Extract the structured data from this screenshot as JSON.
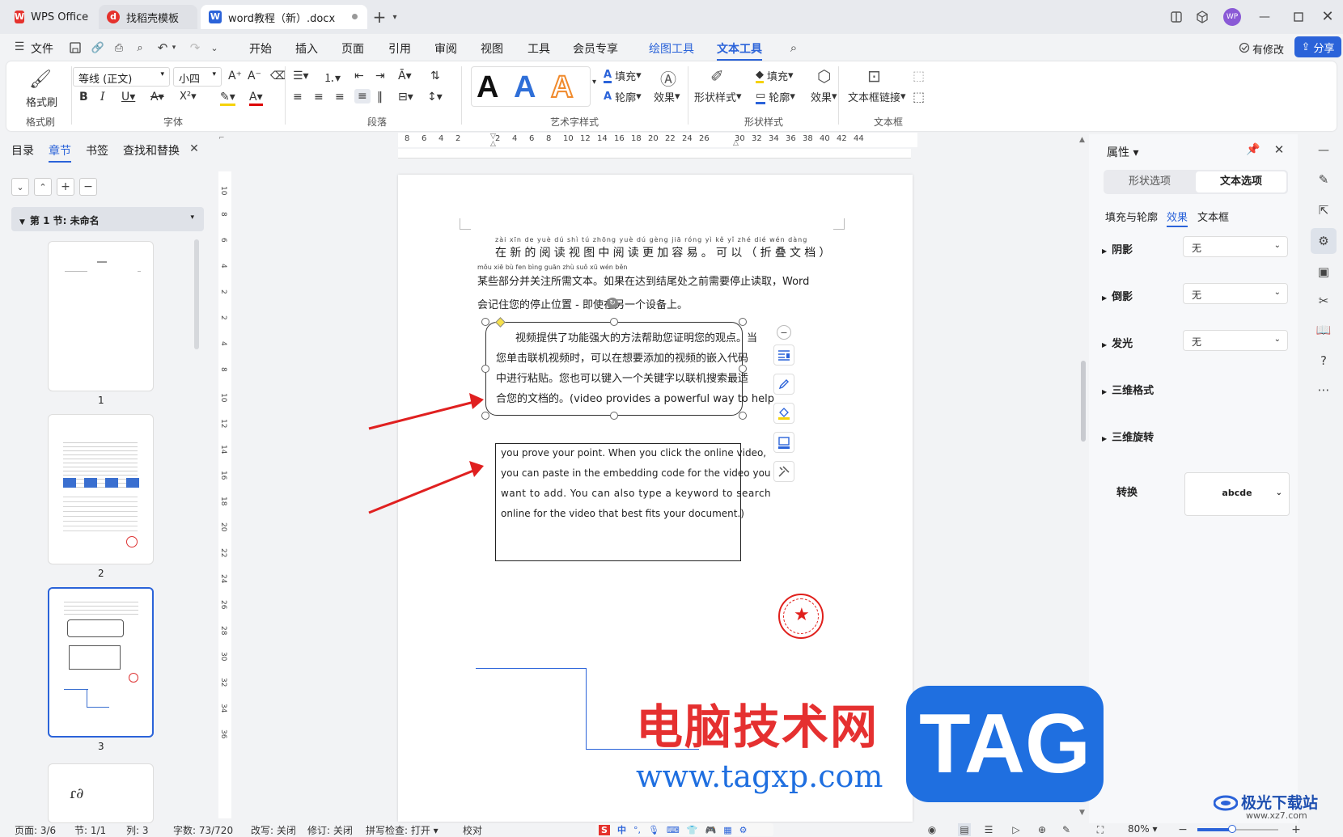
{
  "tabs": [
    {
      "label": "WPS Office"
    },
    {
      "label": "找稻壳模板"
    },
    {
      "label": "word教程（新）.docx"
    }
  ],
  "window": {
    "avatar": "WP"
  },
  "menu": {
    "file": "文件",
    "items": [
      "开始",
      "插入",
      "页面",
      "引用",
      "审阅",
      "视图",
      "工具",
      "会员专享",
      "绘图工具",
      "文本工具"
    ],
    "active": "文本工具",
    "modified": "有修改",
    "share": "分享"
  },
  "ribbon": {
    "format_painter": "格式刷",
    "group_format": "格式刷",
    "font_name": "等线 (正文)",
    "font_size": "小四",
    "group_font": "字体",
    "group_paragraph": "段落",
    "group_art": "艺术字样式",
    "fill": "填充",
    "outline": "轮廓",
    "effect": "效果",
    "shape_style": "形状样式",
    "group_shape": "形状样式",
    "fill2": "填充",
    "outline2": "轮廓",
    "effect2": "效果",
    "textbox_link": "文本框链接",
    "group_textbox": "文本框",
    "art_letter": "A"
  },
  "nav": {
    "tabs": [
      "目录",
      "章节",
      "书签",
      "查找和替换"
    ],
    "active": "章节",
    "section": "第 1 节: 未命名",
    "pages": [
      "1",
      "2",
      "3"
    ]
  },
  "ruler_h": [
    "8",
    "6",
    "4",
    "2",
    "2",
    "4",
    "6",
    "8",
    "10",
    "12",
    "14",
    "16",
    "18",
    "20",
    "22",
    "24",
    "26",
    "30",
    "32",
    "34",
    "36",
    "38",
    "40",
    "42",
    "44"
  ],
  "ruler_v": [
    "10",
    "8",
    "6",
    "4",
    "2",
    "2",
    "4",
    "8",
    "10",
    "12",
    "14",
    "16",
    "18",
    "20",
    "22",
    "24",
    "26",
    "28",
    "30",
    "32",
    "34",
    "36"
  ],
  "document": {
    "pinyin1": "zài xīn de yuè dú shì tú zhōng yuè dú gèng jiā róng yì   kě yǐ   zhé dié wén dàng",
    "line1": "在新的阅读视图中阅读更加容易。可以（折叠文档）",
    "pinyin2": "mǒu xiē bù fen bìng guān zhù suǒ xū wén běn",
    "line2": "某些部分并关注所需文本。如果在达到结尾处之前需要停止读取，Word",
    "line3": "会记住您的停止位置 - 即使在另一个设备上。",
    "box1": [
      "视频提供了功能强大的方法帮助您证明您的观点。当",
      "您单击联机视频时，可以在想要添加的视频的嵌入代码",
      "中进行粘贴。您也可以键入一个关键字以联机搜索最适",
      "合您的文档的。(video provides a powerful way to help"
    ],
    "box2": [
      "you prove your point. When you click the online video,",
      "you can paste in the embedding code for the video you",
      "want to add. You can also type a keyword to search",
      "online for the video that best fits your document.)"
    ]
  },
  "watermark": {
    "text": "电脑技术网",
    "url": "www.tagxp.com",
    "tag": "TAG",
    "site": "极光下载站",
    "site_url": "www.xz7.com"
  },
  "props": {
    "title": "属性",
    "tabs": [
      "形状选项",
      "文本选项"
    ],
    "active_tab": "文本选项",
    "subtabs": [
      "填充与轮廓",
      "效果",
      "文本框"
    ],
    "active_sub": "效果",
    "rows": [
      {
        "label": "阴影",
        "value": "无"
      },
      {
        "label": "倒影",
        "value": "无"
      },
      {
        "label": "发光",
        "value": "无"
      }
    ],
    "fmt3d": "三维格式",
    "rot3d": "三维旋转",
    "transform": "转换",
    "transform_value": "abcde"
  },
  "status": {
    "page": "页面: 3/6",
    "section": "节: 1/1",
    "column": "列: 3",
    "words": "字数: 73/720",
    "rewrite": "改写: 关闭",
    "revise": "修订: 关闭",
    "spell": "拼写检查: 打开",
    "proof": "校对",
    "zoom": "80%",
    "ime": "中"
  },
  "colors": {
    "accent": "#2b63d9",
    "arrow": "#e02020",
    "stamp": "#e0201c",
    "watermark_red": "#e53030",
    "tag_blue": "#1f6fe0"
  }
}
